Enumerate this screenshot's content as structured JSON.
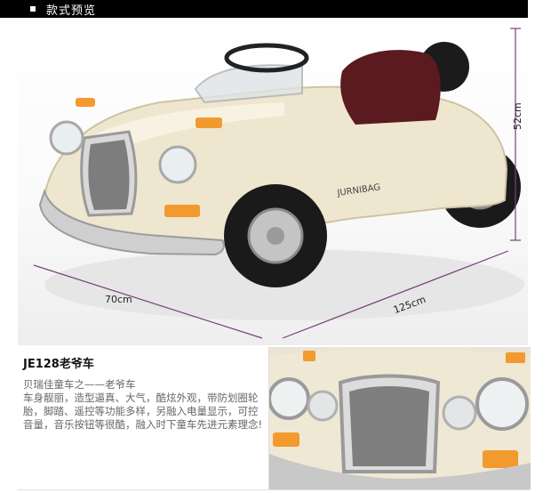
{
  "header": {
    "title": "款式预览"
  },
  "dimensions": {
    "width": "70cm",
    "length": "125cm",
    "height": "52cm"
  },
  "dimension_line_color": "#7a3f7a",
  "car_color": "#efe6cf",
  "seat_color": "#5a1a1f",
  "product": {
    "title": "JE128老爷车",
    "description": "贝瑞佳童车之——老爷车\n车身靓丽，造型逼真、大气，酷炫外观，带防划圈轮胎，脚踏、遥控等功能多样，另融入电量显示，可控音量，音乐按钮等很酷，融入时下童车先进元素理念!"
  },
  "images": {
    "main": "car-photo",
    "detail": "car-front-grille-photo"
  }
}
